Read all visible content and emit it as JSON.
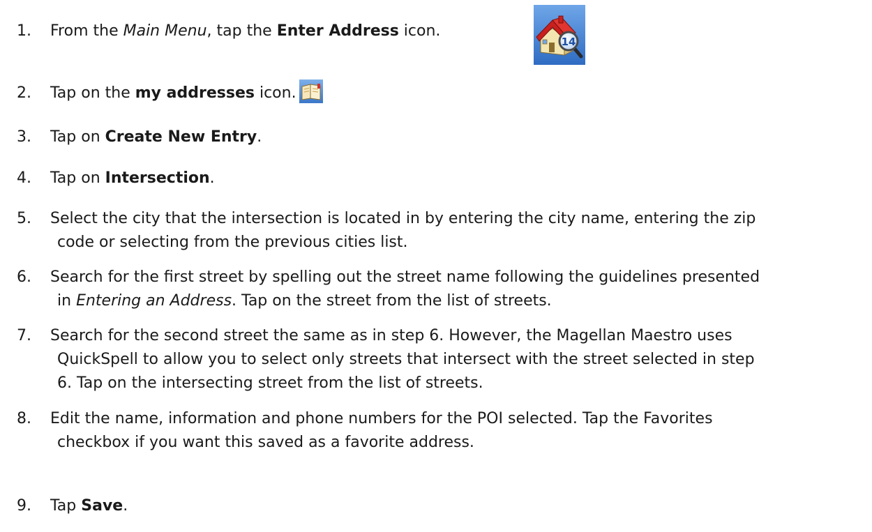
{
  "steps": [
    {
      "num": "1.",
      "pre": "From the ",
      "menu": "Main Menu",
      "mid": ", tap the ",
      "bold": "Enter Address",
      "post": " icon.",
      "icon": "enter-address-house-magnifier-icon"
    },
    {
      "num": "2.",
      "pre": "Tap on the ",
      "bold": "my addresses",
      "post": " icon.",
      "icon": "my-addresses-book-icon"
    },
    {
      "num": "3.",
      "pre": "Tap on ",
      "bold": "Create New Entry",
      "post": "."
    },
    {
      "num": "4.",
      "pre": "Tap on ",
      "bold": "Intersection",
      "post": "."
    },
    {
      "num": "5.",
      "line1": "Select the city that the intersection is located in by entering the city name, entering the zip",
      "line2": "code or selecting from the previous cities list."
    },
    {
      "num": "6.",
      "line1": "Search for the first street by spelling out the street name following the guidelines presented",
      "line2_pre": "in ",
      "line2_ital": "Entering an Address",
      "line2_post": ".  Tap on the street from the list of streets."
    },
    {
      "num": "7.",
      "line1": "Search for the second street the same as in step 6.  However, the Magellan Maestro uses",
      "line2": "QuickSpell to allow you to select only streets that intersect with the street selected in step",
      "line3": "6.  Tap on the intersecting street from the list of streets."
    },
    {
      "num": "8.",
      "line1": "Edit the name, information and phone numbers for the POI selected.  Tap the Favorites",
      "line2": "checkbox if you want this saved as a favorite address."
    },
    {
      "num": "9.",
      "pre": "Tap ",
      "bold": "Save",
      "post": "."
    }
  ],
  "icons": {
    "house_badge_number": "14"
  },
  "colors": {
    "icon_bg_blue": "#3f7fd0",
    "roof_red": "#c8201e",
    "wall_cream": "#f3e6b0"
  }
}
